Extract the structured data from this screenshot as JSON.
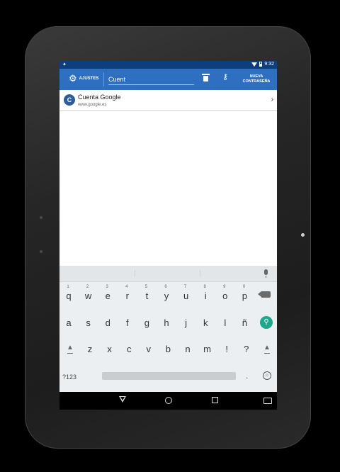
{
  "status": {
    "time": "9:32",
    "notification_icon": "android-icon"
  },
  "actionbar": {
    "settings_label": "AJUSTES",
    "search_value": "Cuent",
    "delete_icon": "trash-icon",
    "key_icon": "add-key-icon",
    "new_password_line1": "NUEVA",
    "new_password_line2": "CONTRASEÑA"
  },
  "list": {
    "items": [
      {
        "avatar_letter": "C",
        "title": "Cuenta Google",
        "subtitle": "www.google.es"
      }
    ]
  },
  "keyboard": {
    "numbers": [
      "1",
      "2",
      "3",
      "4",
      "5",
      "6",
      "7",
      "8",
      "9",
      "0"
    ],
    "row1": [
      "q",
      "w",
      "e",
      "r",
      "t",
      "y",
      "u",
      "i",
      "o",
      "p"
    ],
    "row2": [
      "a",
      "s",
      "d",
      "f",
      "g",
      "h",
      "j",
      "k",
      "l",
      "ñ"
    ],
    "row3": [
      "z",
      "x",
      "c",
      "v",
      "b",
      "n",
      "m",
      "!",
      "?"
    ],
    "symbols_label": "?123",
    "period_label": "."
  },
  "colors": {
    "actionbar": "#2f6fc1",
    "statusbar": "#0d3f7c",
    "search_key": "#1fa68f",
    "avatar": "#2c5c9b"
  }
}
